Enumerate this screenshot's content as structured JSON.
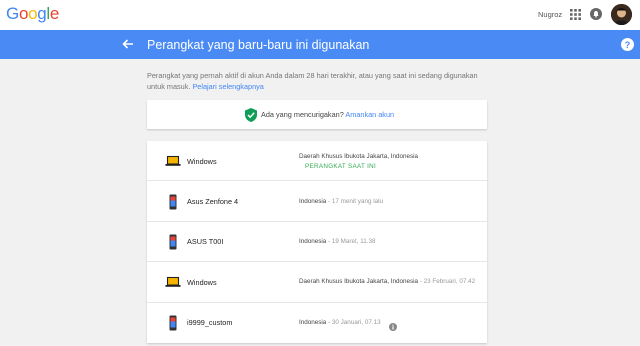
{
  "header": {
    "logo_letters": [
      {
        "char": "G",
        "color": "#4285f4"
      },
      {
        "char": "o",
        "color": "#ea4335"
      },
      {
        "char": "o",
        "color": "#fbbc05"
      },
      {
        "char": "g",
        "color": "#4285f4"
      },
      {
        "char": "l",
        "color": "#34a853"
      },
      {
        "char": "e",
        "color": "#ea4335"
      }
    ],
    "user_name": "Nugroz"
  },
  "title_bar": {
    "title": "Perangkat yang baru-baru ini digunakan",
    "color": "#4a8af4"
  },
  "intro": {
    "text": "Perangkat yang pernah aktif di akun Anda dalam 28 hari terakhir, atau yang saat ini sedang digunakan untuk masuk.",
    "link": "Pelajari selengkapnya"
  },
  "alert": {
    "question": "Ada yang mencurigakan?",
    "link": "Amankan akun"
  },
  "devices": [
    {
      "name": "Windows",
      "icon": "laptop-icon",
      "location": "Daerah Khusus Ibukota Jakarta, Indonesia",
      "time": "",
      "current": "PERANGKAT SAAT INI",
      "info": false
    },
    {
      "name": "Asus Zenfone 4",
      "icon": "phone-icon",
      "location": "Indonesia",
      "time": " - 17 menit yang lalu",
      "current": "",
      "info": false
    },
    {
      "name": "ASUS T00I",
      "icon": "phone-icon",
      "location": "Indonesia",
      "time": " - 19 Maret, 11.38",
      "current": "",
      "info": false
    },
    {
      "name": "Windows",
      "icon": "laptop-icon",
      "location": "Daerah Khusus Ibukota Jakarta, Indonesia",
      "time": " - 23 Februari, 07.42",
      "current": "",
      "info": false
    },
    {
      "name": "i9999_custom",
      "icon": "phone-icon",
      "location": "Indonesia",
      "time": " - 30 Januari, 07.13",
      "current": "",
      "info": true
    }
  ]
}
